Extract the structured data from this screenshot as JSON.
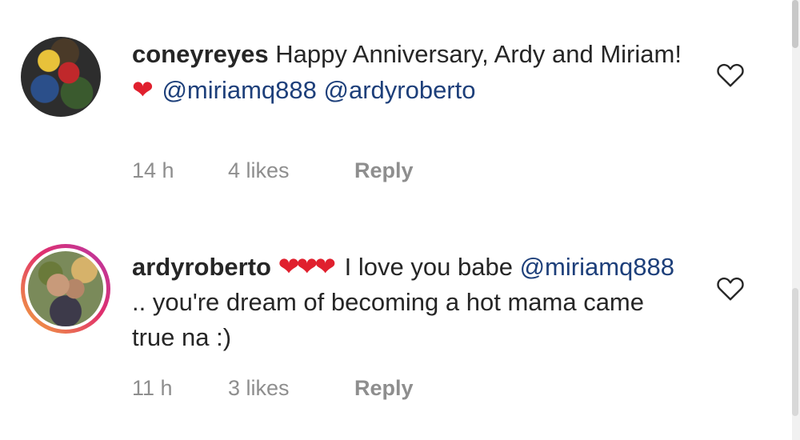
{
  "comments": [
    {
      "username": "coneyreyes",
      "text_before": "Happy Anniversary, Ardy and Miriam!",
      "heart": "❤",
      "mention_1": "@miriamq888",
      "mention_2": "@ardyroberto",
      "time": "14 h",
      "likes": "4 likes",
      "reply": "Reply"
    },
    {
      "username": "ardyroberto",
      "hearts": "❤❤❤",
      "text_before": "I love you babe",
      "mention_1": "@miriamq888",
      "text_after": ".. you're dream of becoming a hot mama came true na :)",
      "time": "11 h",
      "likes": "3 likes",
      "reply": "Reply"
    }
  ],
  "icons": {
    "like": "heart-outline-icon"
  },
  "colors": {
    "heart": "#e0202e",
    "mention": "#1d3f7a",
    "meta": "#8e8e8e",
    "story_ring_start": "#f2a93b",
    "story_ring_end": "#b537a8"
  }
}
